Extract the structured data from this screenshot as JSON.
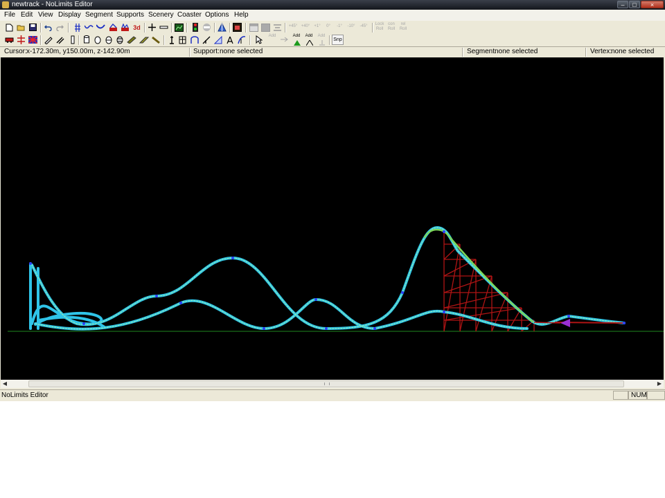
{
  "window": {
    "title": "newtrack - NoLimits Editor",
    "min": "–",
    "max": "□",
    "close": "×"
  },
  "menu": [
    "File",
    "Edit",
    "View",
    "Display",
    "Segment",
    "Supports",
    "Scenery",
    "Coaster",
    "Options",
    "Help"
  ],
  "toolbar1": {
    "nudges": [
      "+45°",
      "+40°",
      "+1°",
      "0°",
      "-1°",
      "-10°",
      "-45°"
    ],
    "lock_roll": [
      "Lock",
      "Roll"
    ],
    "con_roll": [
      "con",
      "Roll"
    ],
    "rel_roll": [
      "rel",
      "Roll"
    ],
    "three_d": "3d"
  },
  "toolbar2": {
    "add_labels": [
      "Add",
      "Add",
      "Add",
      "Add"
    ],
    "snap": "Snp"
  },
  "status": {
    "cursor_label": "Cursor:",
    "cursor_value": "x-172.30m, y150.00m, z-142.90m",
    "support_label": "Support:",
    "support_value": "none selected",
    "segment_label": "Segment:",
    "segment_value": "none selected",
    "vertex_label": "Vertex:",
    "vertex_value": "none selected"
  },
  "bottom": {
    "app_name": "NoLimits Editor",
    "num": "NUM"
  },
  "colors": {
    "track": "#2fc4e8",
    "rail_highlight": "#9ff0a0",
    "support": "#c01818",
    "ground": "#1f8a1f",
    "node": "#2a3fff"
  }
}
